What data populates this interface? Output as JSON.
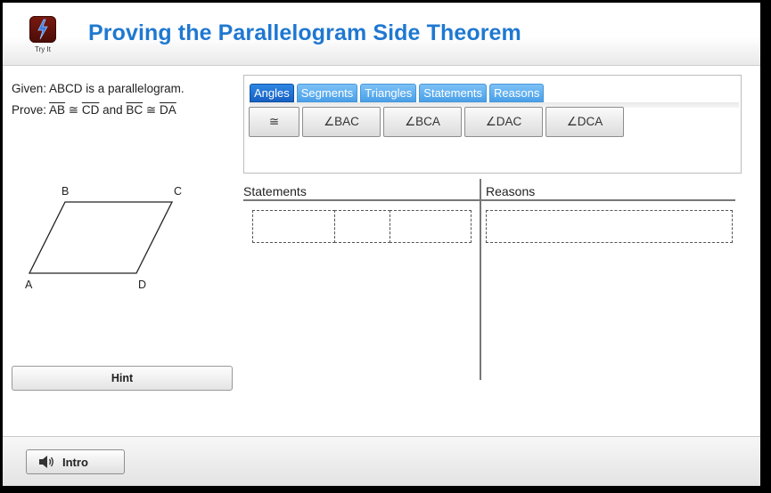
{
  "app": {
    "icon_name": "lightning-bolt-icon",
    "icon_label": "Try It",
    "title": "Proving the Parallelogram Side Theorem",
    "title_color": "#1f78d1"
  },
  "given": {
    "given_text": "Given: ABCD is a parallelogram.",
    "prove_prefix": "Prove: ",
    "seg1": "AB",
    "cong1": " ≅ ",
    "seg2": "CD",
    "and": " and ",
    "seg3": "BC",
    "cong2": " ≅ ",
    "seg4": "DA"
  },
  "diagram": {
    "labels": {
      "A": "A",
      "B": "B",
      "C": "C",
      "D": "D"
    }
  },
  "palette": {
    "tabs": [
      "Angles",
      "Segments",
      "Triangles",
      "Statements",
      "Reasons"
    ],
    "active_tab": "Angles",
    "chips": [
      "≅",
      "∠BAC",
      "∠BCA",
      "∠DAC",
      "∠DCA"
    ]
  },
  "proof": {
    "statements_header": "Statements",
    "reasons_header": "Reasons"
  },
  "buttons": {
    "hint": "Hint",
    "intro": "Intro"
  }
}
